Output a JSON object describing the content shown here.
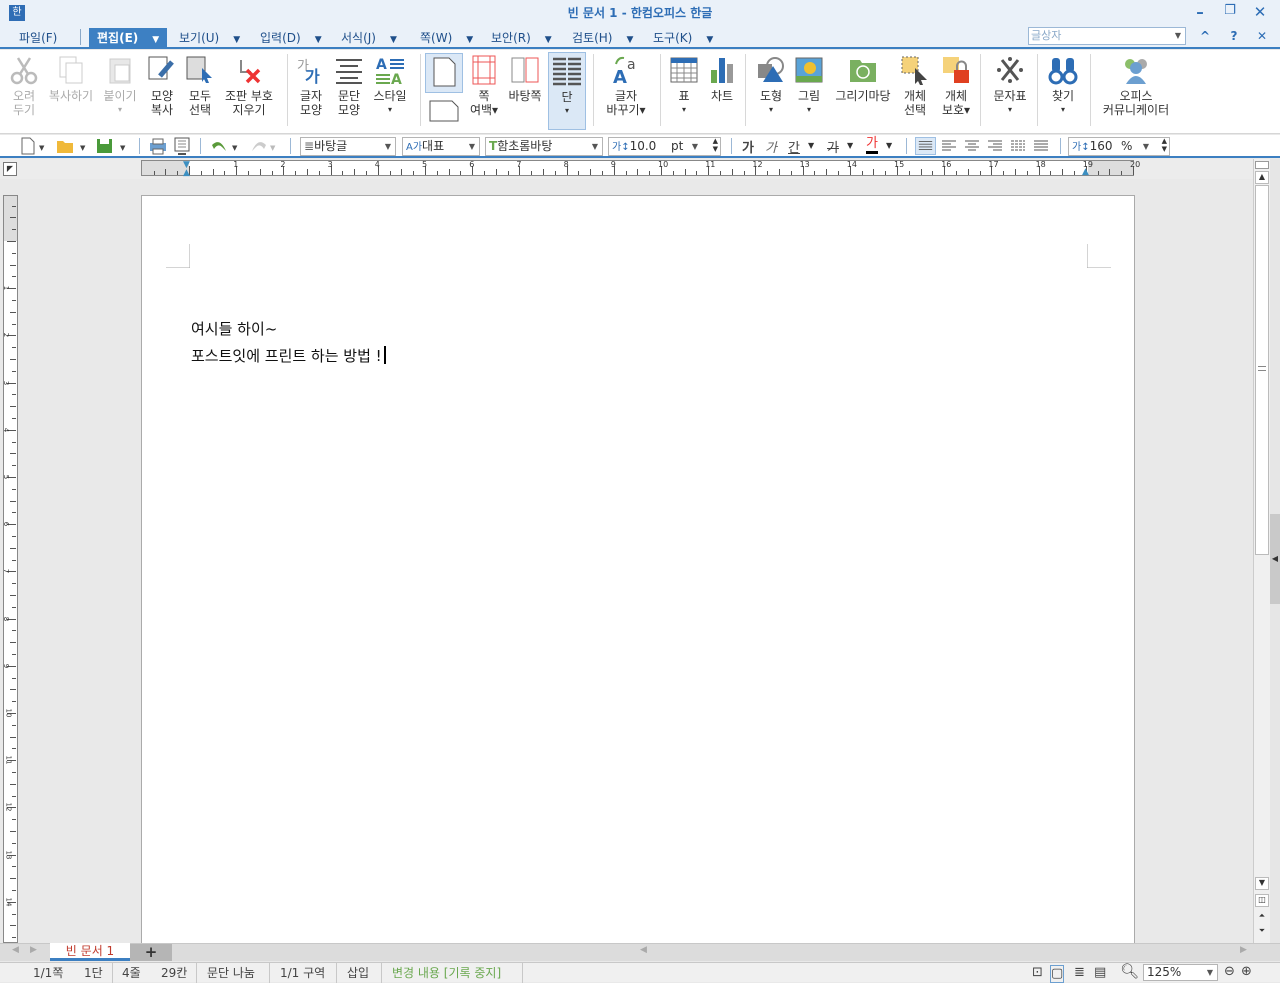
{
  "window": {
    "title": "빈 문서 1 - 한컴오피스 한글",
    "app_icon": "한"
  },
  "menu": [
    {
      "label": "파일(F)"
    },
    {
      "label": "편집(E)"
    },
    {
      "label": "보기(U)"
    },
    {
      "label": "입력(D)"
    },
    {
      "label": "서식(J)"
    },
    {
      "label": "쪽(W)"
    },
    {
      "label": "보안(R)"
    },
    {
      "label": "검토(H)"
    },
    {
      "label": "도구(K)"
    }
  ],
  "search": {
    "placeholder": "글상자"
  },
  "ribbon": [
    {
      "l1": "오려",
      "l2": "두기"
    },
    {
      "l1": "복사하기",
      "l2": ""
    },
    {
      "l1": "붙이기",
      "l2": "▾"
    },
    {
      "l1": "모양",
      "l2": "복사"
    },
    {
      "l1": "모두",
      "l2": "선택"
    },
    {
      "l1": "조판 부호",
      "l2": "지우기"
    },
    {
      "l1": "글자",
      "l2": "모양"
    },
    {
      "l1": "문단",
      "l2": "모양"
    },
    {
      "l1": "스타일",
      "l2": "▾"
    },
    {
      "l1": "쪽",
      "l2": "여백▾"
    },
    {
      "l1": "바탕쪽",
      "l2": ""
    },
    {
      "l1": "단",
      "l2": "▾"
    },
    {
      "l1": "글자",
      "l2": "바꾸기▾"
    },
    {
      "l1": "표",
      "l2": "▾"
    },
    {
      "l1": "차트",
      "l2": ""
    },
    {
      "l1": "도형",
      "l2": "▾"
    },
    {
      "l1": "그림",
      "l2": "▾"
    },
    {
      "l1": "그리기마당",
      "l2": ""
    },
    {
      "l1": "개체",
      "l2": "선택"
    },
    {
      "l1": "개체",
      "l2": "보호▾"
    },
    {
      "l1": "문자표",
      "l2": "▾"
    },
    {
      "l1": "찾기",
      "l2": "▾"
    },
    {
      "l1": "오피스",
      "l2": "커뮤니케이터"
    }
  ],
  "toolbar": {
    "style": "바탕글",
    "language": "대표",
    "font": "함초롬바탕",
    "size": "10.0",
    "unit": "pt",
    "bold": "가",
    "italic": "가",
    "underline": "간",
    "strike": "가",
    "color": "가",
    "line_spacing": "160",
    "percent": "%"
  },
  "ruler": {
    "h": [
      "1",
      "2",
      "3",
      "4",
      "5",
      "6",
      "7",
      "8",
      "9",
      "10",
      "11",
      "12",
      "13",
      "14",
      "15",
      "16",
      "17",
      "18",
      "19",
      "20"
    ],
    "v": [
      "1",
      "2",
      "3",
      "4",
      "5",
      "6",
      "7",
      "8",
      "9",
      "10",
      "11",
      "12",
      "13",
      "14"
    ]
  },
  "document": {
    "lines": [
      "여시들 하이~",
      "포스트잇에 프린트 하는 방법 !"
    ]
  },
  "tabs": {
    "doc": "빈 문서 1",
    "add": "+"
  },
  "status": {
    "page": "1/1쪽",
    "column": "1단",
    "line": "4줄",
    "col": "29칸",
    "para_break": "문단 나눔",
    "section": "1/1 구역",
    "mode": "삽입",
    "track": "변경 내용 [기록 중지]",
    "zoom": "125%"
  }
}
